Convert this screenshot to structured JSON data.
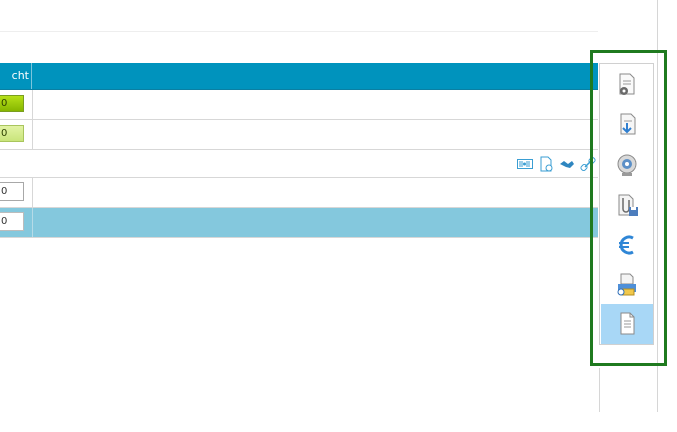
{
  "table": {
    "header_partial_label": "cht",
    "rows": [
      {
        "kind": "pill-strong",
        "value": "0"
      },
      {
        "kind": "pill-light",
        "value": "0"
      },
      {
        "kind": "actions"
      },
      {
        "kind": "input",
        "value": "0"
      },
      {
        "kind": "input-selected",
        "value": "0"
      }
    ],
    "row_actions": [
      "barcode-icon",
      "document-euro-icon",
      "handshake-icon",
      "link-icon"
    ]
  },
  "toolbar": {
    "buttons": [
      {
        "icon": "document-settings-icon"
      },
      {
        "icon": "document-import-icon"
      },
      {
        "icon": "webcam-icon"
      },
      {
        "icon": "attachment-save-icon"
      },
      {
        "icon": "euro-icon"
      },
      {
        "icon": "email-print-icon"
      },
      {
        "icon": "document-icon",
        "active": true
      }
    ]
  },
  "colors": {
    "header": "#0093bd",
    "selected_row": "#84c8dd",
    "active_button": "#a8d7f6",
    "highlight_outline": "#1f7a1f"
  }
}
